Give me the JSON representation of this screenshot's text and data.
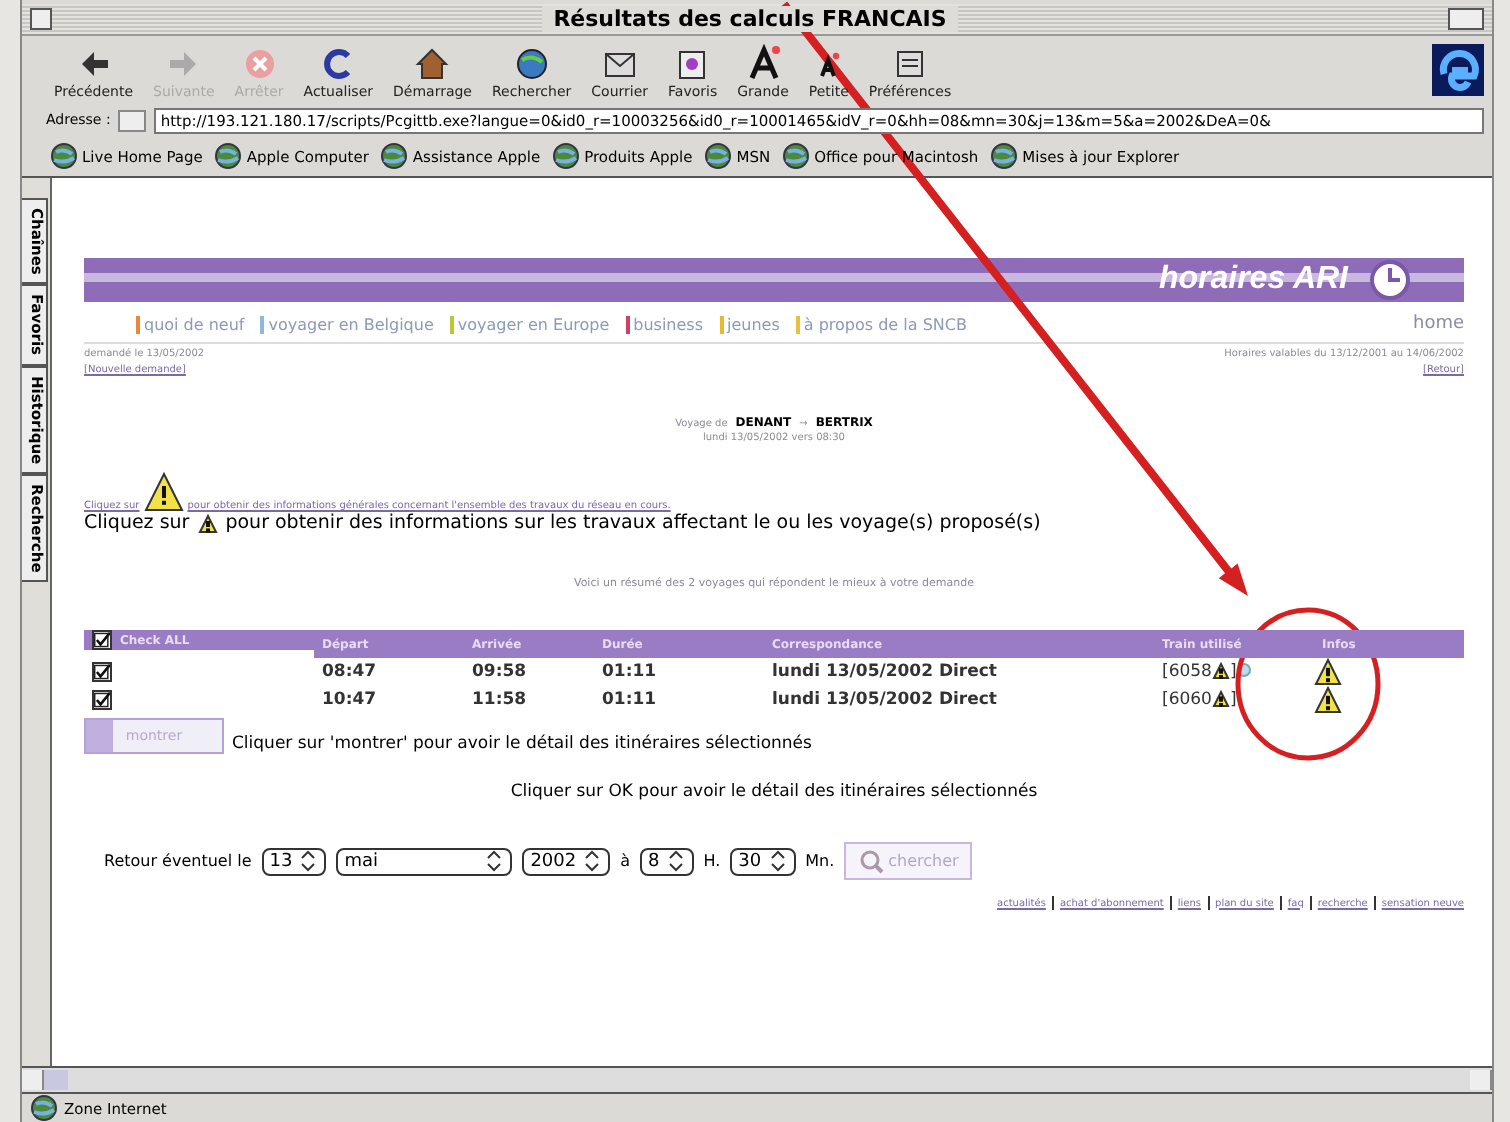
{
  "window": {
    "title": "Résultats des calculs FRANCAIS"
  },
  "toolbar": [
    {
      "label": "Précédente",
      "kind": "back",
      "disabled": false
    },
    {
      "label": "Suivante",
      "kind": "forward",
      "disabled": true
    },
    {
      "label": "Arrêter",
      "kind": "stop",
      "disabled": true
    },
    {
      "label": "Actualiser",
      "kind": "refresh",
      "disabled": false
    },
    {
      "label": "Démarrage",
      "kind": "home",
      "disabled": false
    },
    {
      "label": "Rechercher",
      "kind": "search",
      "disabled": false
    },
    {
      "label": "Courrier",
      "kind": "mail",
      "disabled": false
    },
    {
      "label": "Favoris",
      "kind": "favorites",
      "disabled": false
    },
    {
      "label": "Grande",
      "kind": "bigger",
      "disabled": false
    },
    {
      "label": "Petite",
      "kind": "smaller",
      "disabled": false
    },
    {
      "label": "Préférences",
      "kind": "prefs",
      "disabled": false
    }
  ],
  "address": {
    "label": "Adresse :",
    "value": "http://193.121.180.17/scripts/Pcgittb.exe?langue=0&id0_r=10003256&id0_r=10001465&idV_r=0&hh=08&mn=30&j=13&m=5&a=2002&DeA=0&"
  },
  "favorites": [
    "Live Home Page",
    "Apple Computer",
    "Assistance Apple",
    "Produits Apple",
    "MSN",
    "Office pour Macintosh",
    "Mises à jour Explorer"
  ],
  "side_tabs": [
    "Chaînes",
    "Favoris",
    "Historique",
    "Recherche"
  ],
  "page": {
    "banner": "horaires ARI",
    "nav": [
      {
        "label": "quoi de neuf",
        "color": "#e8893a"
      },
      {
        "label": "voyager en Belgique",
        "color": "#8fb8e0"
      },
      {
        "label": "voyager en Europe",
        "color": "#b8c83a"
      },
      {
        "label": "business",
        "color": "#d04060"
      },
      {
        "label": "jeunes",
        "color": "#e8b830"
      },
      {
        "label": "à propos de la SNCB",
        "color": "#e8c040"
      }
    ],
    "home": "home",
    "demand_date": "demandé le 13/05/2002",
    "new_request": "[Nouvelle demande]",
    "validity": "Horaires valables du 13/12/2001 au 14/06/2002",
    "back_link": "[Retour]",
    "trip": {
      "prefix": "Voyage de",
      "from": "DENANT",
      "arrow": "→",
      "to": "BERTRIX",
      "when": "lundi 13/05/2002 vers 08:30"
    },
    "general_info": {
      "lead": "Cliquez sur",
      "rest": "pour obtenir des informations générales concernant l'ensemble des travaux du réseau en cours."
    },
    "works_info": {
      "lead": "Cliquez sur",
      "rest": "pour obtenir des informations sur les travaux affectant le ou les voyage(s) proposé(s)"
    },
    "summary": "Voici un résumé des 2 voyages qui répondent le mieux à votre demande",
    "table": {
      "check_all": {
        "label": "Check ALL",
        "checked": true
      },
      "columns": [
        "Départ",
        "Arrivée",
        "Durée",
        "Correspondance",
        "Train utilisé",
        "Infos"
      ],
      "rows": [
        {
          "checked": true,
          "depart": "08:47",
          "arrivee": "09:58",
          "duree": "01:11",
          "correspondance": "lundi 13/05/2002 Direct",
          "train": "6058",
          "bracket_open": "[",
          "bracket_close": "]",
          "info_dot": true
        },
        {
          "checked": true,
          "depart": "10:47",
          "arrivee": "11:58",
          "duree": "01:11",
          "correspondance": "lundi 13/05/2002 Direct",
          "train": "6060",
          "bracket_open": "[",
          "bracket_close": "]",
          "info_dot": false
        }
      ]
    },
    "show_button": "montrer",
    "show_hint": "Cliquer sur 'montrer' pour avoir le détail des itinéraires sélectionnés",
    "ok_hint": "Cliquer sur OK pour avoir le détail des itinéraires sélectionnés",
    "return": {
      "label": "Retour éventuel le",
      "day": "13",
      "month": "mai",
      "year": "2002",
      "at": "à",
      "hour": "8",
      "h": "H.",
      "minute": "30",
      "mn": "Mn.",
      "search": "chercher"
    },
    "footer_links": [
      "actualités",
      "achat d'abonnement",
      "liens",
      "plan du site",
      "faq",
      "recherche",
      "sensation neuve"
    ]
  },
  "status_bar": {
    "zone": "Zone Internet"
  }
}
